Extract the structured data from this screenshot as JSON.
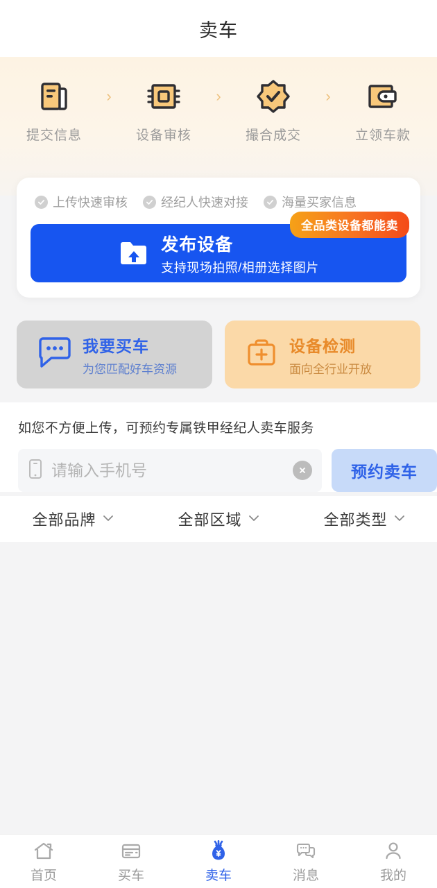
{
  "header": {
    "title": "卖车"
  },
  "steps": {
    "arrow_glyph": "›",
    "items": [
      {
        "label": "提交信息",
        "icon": "document-icon"
      },
      {
        "label": "设备审核",
        "icon": "chip-icon"
      },
      {
        "label": "撮合成交",
        "icon": "verified-badge-icon"
      },
      {
        "label": "立领车款",
        "icon": "wallet-icon"
      }
    ]
  },
  "publish_card": {
    "features": [
      {
        "text": "上传快速审核"
      },
      {
        "text": "经纪人快速对接"
      },
      {
        "text": "海量买家信息"
      }
    ],
    "badge": "全品类设备都能卖",
    "title": "发布设备",
    "subtitle": "支持现场拍照/相册选择图片",
    "accent_color": "#1755f0"
  },
  "action_cards": [
    {
      "title": "我要买车",
      "subtitle": "为您匹配好车资源",
      "icon": "chat-bubble-icon",
      "bg_color": "#d3d3d3",
      "title_color": "#2f62e8"
    },
    {
      "title": "设备检测",
      "subtitle": "面向全行业开放",
      "icon": "toolbox-plus-icon",
      "bg_color": "#fbd9a8",
      "title_color": "#e88a2a"
    }
  ],
  "agent": {
    "note": "如您不方便上传，可预约专属铁甲经纪人卖车服务",
    "phone_placeholder": "请输入手机号",
    "phone_value": "",
    "phone_icon": "mobile-phone-icon",
    "clear_icon": "clear-circle-icon",
    "reserve_label": "预约卖车",
    "reserve_bg": "#c7daf9"
  },
  "filters": [
    {
      "label": "全部品牌"
    },
    {
      "label": "全部区域"
    },
    {
      "label": "全部类型"
    }
  ],
  "tabbar": {
    "items": [
      {
        "label": "首页",
        "icon": "home-icon",
        "active": false
      },
      {
        "label": "买车",
        "icon": "card-icon",
        "active": false
      },
      {
        "label": "卖车",
        "icon": "money-bag-icon",
        "active": true
      },
      {
        "label": "消息",
        "icon": "message-icon",
        "active": false
      },
      {
        "label": "我的",
        "icon": "person-icon",
        "active": false
      }
    ],
    "active_color": "#2f62e8"
  }
}
